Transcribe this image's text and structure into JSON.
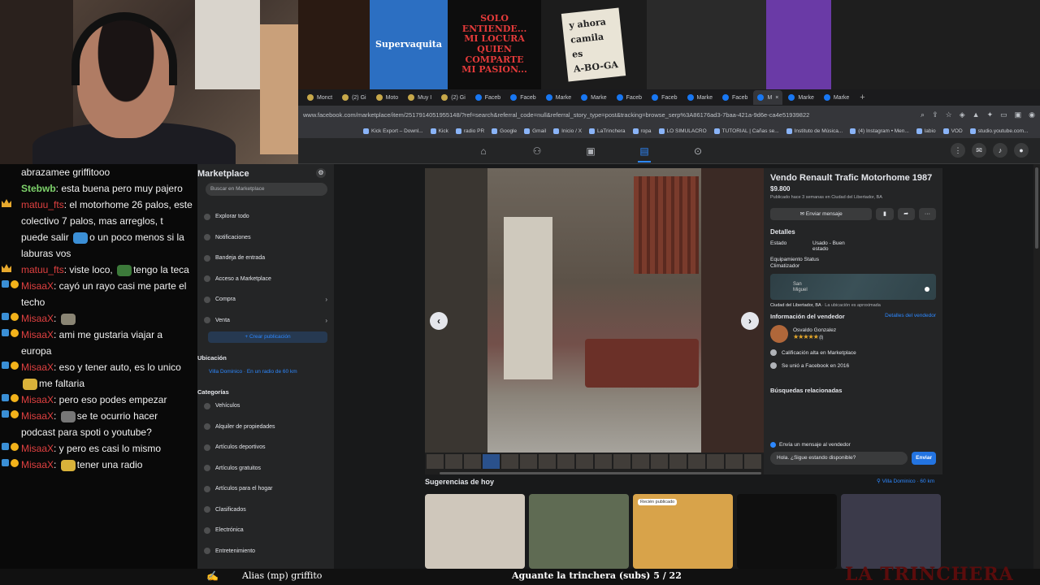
{
  "strip_tiles": [
    {
      "text": "",
      "bg": "#2a1a12",
      "color": "#fff",
      "w": 88
    },
    {
      "text": "Supervaquita",
      "bg": "#2c6fc2",
      "color": "#fff",
      "w": 96
    },
    {
      "text": "SOLO ENTIENDE...\nMI LOCURA\nQUIEN COMPARTE\nMI PASION...",
      "bg": "#0d0d0d",
      "color": "#e23a3a",
      "w": 115
    },
    {
      "text": "y ahora\ncamila\nes\nA-BO-GA",
      "bg": "#1c1c1c",
      "color": "#222",
      "w": 130
    },
    {
      "text": "",
      "bg": "#2a2a2a",
      "color": "#fff",
      "w": 147
    },
    {
      "text": "",
      "bg": "#6a3aa6",
      "color": "#fff",
      "w": 80
    },
    {
      "text": "",
      "bg": "#1e1e1e",
      "color": "#fff",
      "w": 257
    }
  ],
  "tabs": [
    {
      "label": "Monct",
      "type": "gen"
    },
    {
      "label": "(2) Gi",
      "type": "gen"
    },
    {
      "label": "Moto",
      "type": "gen"
    },
    {
      "label": "Muy I",
      "type": "gen"
    },
    {
      "label": "(2) Gi",
      "type": "gen"
    },
    {
      "label": "Faceb",
      "type": "fb"
    },
    {
      "label": "Faceb",
      "type": "fb"
    },
    {
      "label": "Marke",
      "type": "fb"
    },
    {
      "label": "Marke",
      "type": "fb"
    },
    {
      "label": "Faceb",
      "type": "fb"
    },
    {
      "label": "Faceb",
      "type": "fb"
    },
    {
      "label": "Marke",
      "type": "fb"
    },
    {
      "label": "Faceb",
      "type": "fb"
    },
    {
      "label": "M",
      "type": "fb",
      "active": true
    },
    {
      "label": "Marke",
      "type": "fb"
    },
    {
      "label": "Marke",
      "type": "fb"
    }
  ],
  "url": "www.facebook.com/marketplace/item/2517914051955148/?ref=search&referral_code=null&referral_story_type=post&tracking=browse_serp%3A86176ad3-7baa-421a-9d6e-ca4e51939822",
  "bookmarks": [
    "Kick Export – Downl...",
    "Kick",
    "radio PR",
    "Google",
    "Gmail",
    "Inicio / X",
    "LaTrinchera",
    "ropa",
    "LO SIMULACRO",
    "TUTORIAL | Cañas se...",
    "Instituto de Música...",
    "(4) Instagram • Men...",
    "labio",
    "VOD",
    "studio.youtube.com..."
  ],
  "chat": [
    {
      "user": "",
      "text": "abrazamee griffitooo",
      "badges": "none"
    },
    {
      "user": "Stebwb",
      "ucls": "u-green",
      "text": ": esta buena pero muy pajero",
      "badges": "none"
    },
    {
      "user": "matuu_fts",
      "ucls": "u-red",
      "text": ": el motorhome 26 palos, este colectivo 7 palos, mas arreglos, t puede salir",
      "emote": "#3b8fd6",
      "text2": "o un poco menos si la laburas vos",
      "badges": "crown"
    },
    {
      "user": "matuu_fts",
      "ucls": "u-red",
      "text": ": viste loco,",
      "emote": "#3c7a3a",
      "text2": "tengo la teca",
      "badges": "crown"
    },
    {
      "user": "MisaaX",
      "ucls": "u-red",
      "text": ": cayó un rayo casi me parte el techo",
      "badges": "sub"
    },
    {
      "user": "MisaaX",
      "ucls": "u-red",
      "text": ":",
      "emote": "#8a8574",
      "text2": "",
      "badges": "sub"
    },
    {
      "user": "MisaaX",
      "ucls": "u-red",
      "text": ": ami me gustaria viajar a europa",
      "badges": "sub"
    },
    {
      "user": "MisaaX",
      "ucls": "u-red",
      "text": ": eso y tener auto, es lo unico",
      "emote": "#d9b23a",
      "text2": "me faltaria",
      "badges": "sub"
    },
    {
      "user": "MisaaX",
      "ucls": "u-red",
      "text": ": pero eso podes empezar",
      "badges": "sub"
    },
    {
      "user": "MisaaX",
      "ucls": "u-red",
      "text": ":",
      "emote": "#777",
      "text2": "se te ocurrio hacer podcast para spoti o youtube?",
      "badges": "sub"
    },
    {
      "user": "MisaaX",
      "ucls": "u-red",
      "text": ": y pero es casi lo mismo",
      "badges": "sub"
    },
    {
      "user": "MisaaX",
      "ucls": "u-red",
      "text": ":",
      "emote": "#d9b23a",
      "text2": "tener una radio",
      "badges": "sub"
    }
  ],
  "sidebar": {
    "title": "Marketplace",
    "search_placeholder": "Buscar en Marketplace",
    "items": [
      {
        "label": "Explorar todo"
      },
      {
        "label": "Notificaciones"
      },
      {
        "label": "Bandeja de entrada"
      },
      {
        "label": "Acceso a Marketplace"
      },
      {
        "label": "Compra",
        "chev": true
      },
      {
        "label": "Venta",
        "chev": true
      }
    ],
    "create": "+ Crear publicación",
    "loc_header": "Ubicación",
    "loc": "Villa Dominico · En un radio de 60 km",
    "cat_header": "Categorías",
    "categories": [
      "Vehículos",
      "Alquiler de propiedades",
      "Artículos deportivos",
      "Artículos gratuitos",
      "Artículos para el hogar",
      "Clasificados",
      "Electrónica",
      "Entretenimiento"
    ]
  },
  "listing": {
    "title": "Vendo Renault Trafic Motorhome 1987",
    "price": "$9.800",
    "published": "Publicado hace 3 semanas en Ciudad del Libertador, BA",
    "msg_button": "Enviar mensaje",
    "details_h": "Detalles",
    "estado_k": "Estado",
    "estado_v": "Usado - Buen estado",
    "equip": "Equipamiento Status Climatizador",
    "map_label": "San Miguel",
    "loc": "Ciudad del Libertador, BA",
    "loc_note": " · La ubicación es aproximada",
    "seller_h": "Información del vendedor",
    "seller_link": "Detalles del vendedor",
    "seller_name": "Osvaldo Gonzalez",
    "stars": "★★★★★",
    "rating_count": "(8)",
    "info1": "Calificación alta en Marketplace",
    "info2": "Se unió a Facebook en 2016",
    "related": "Búsquedas relacionadas",
    "send_check": "Envía un mensaje al vendedor",
    "send_input": "Hola. ¿Sigue estando disponible?",
    "send_btn": "Enviar"
  },
  "suggestions": {
    "title": "Sugerencias de hoy",
    "loc": "Villa Dominico · 60 km",
    "items": [
      {
        "bg": "#cfc7bb",
        "tag": ""
      },
      {
        "bg": "#5f6b53",
        "tag": ""
      },
      {
        "bg": "#d8a34a",
        "tag": "Recién publicado"
      },
      {
        "bg": "#0f0f0f",
        "tag": ""
      },
      {
        "bg": "#3b3a4a",
        "tag": ""
      }
    ]
  },
  "bottom": {
    "alias": "Alias (mp) griffito",
    "goal": "Aguante la trinchera (subs) 5 / 22",
    "brand": "LA TRINCHERA"
  }
}
